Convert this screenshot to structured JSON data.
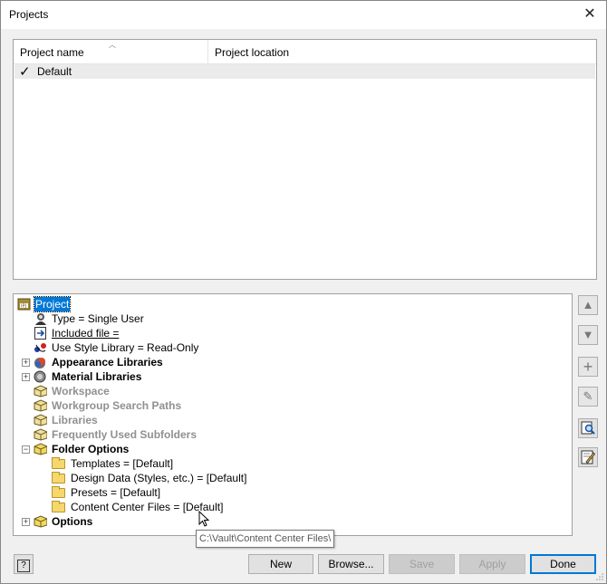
{
  "window": {
    "title": "Projects",
    "close_glyph": "✕"
  },
  "project_list": {
    "columns": [
      "Project name",
      "Project location"
    ],
    "rows": [
      {
        "name": "Default",
        "location": "",
        "active_mark": "✓"
      }
    ]
  },
  "tree": {
    "root": "Project",
    "type_line": "Type = Single User",
    "included_file": "Included file = ",
    "use_style_library": "Use Style Library = Read-Only",
    "appearance_libraries": "Appearance Libraries",
    "material_libraries": "Material Libraries",
    "workspace": "Workspace",
    "workgroup_search_paths": "Workgroup Search Paths",
    "libraries": "Libraries",
    "frequently_used_subfolders": "Frequently Used Subfolders",
    "folder_options": "Folder Options",
    "templates": "Templates = [Default]",
    "design_data": "Design Data (Styles, etc.) = [Default]",
    "presets": "Presets = [Default]",
    "content_center_files": "Content Center Files = [Default]",
    "options": "Options",
    "plus": "+",
    "minus": "−"
  },
  "tooltip": "C:\\Vault\\Content Center Files\\",
  "side_buttons": {
    "move_up": "▲",
    "move_down": "▼",
    "add": "+",
    "edit": "✎",
    "find": "🔍",
    "edit_all": "✎"
  },
  "buttons": {
    "help": "?",
    "new": "New",
    "browse": "Browse...",
    "save": "Save",
    "apply": "Apply",
    "done": "Done"
  },
  "colors": {
    "selection": "#0078d7",
    "dialog_bg": "#f0f0f0",
    "folder": "#f5d76e",
    "disabled_text": "#a0a0a0"
  }
}
